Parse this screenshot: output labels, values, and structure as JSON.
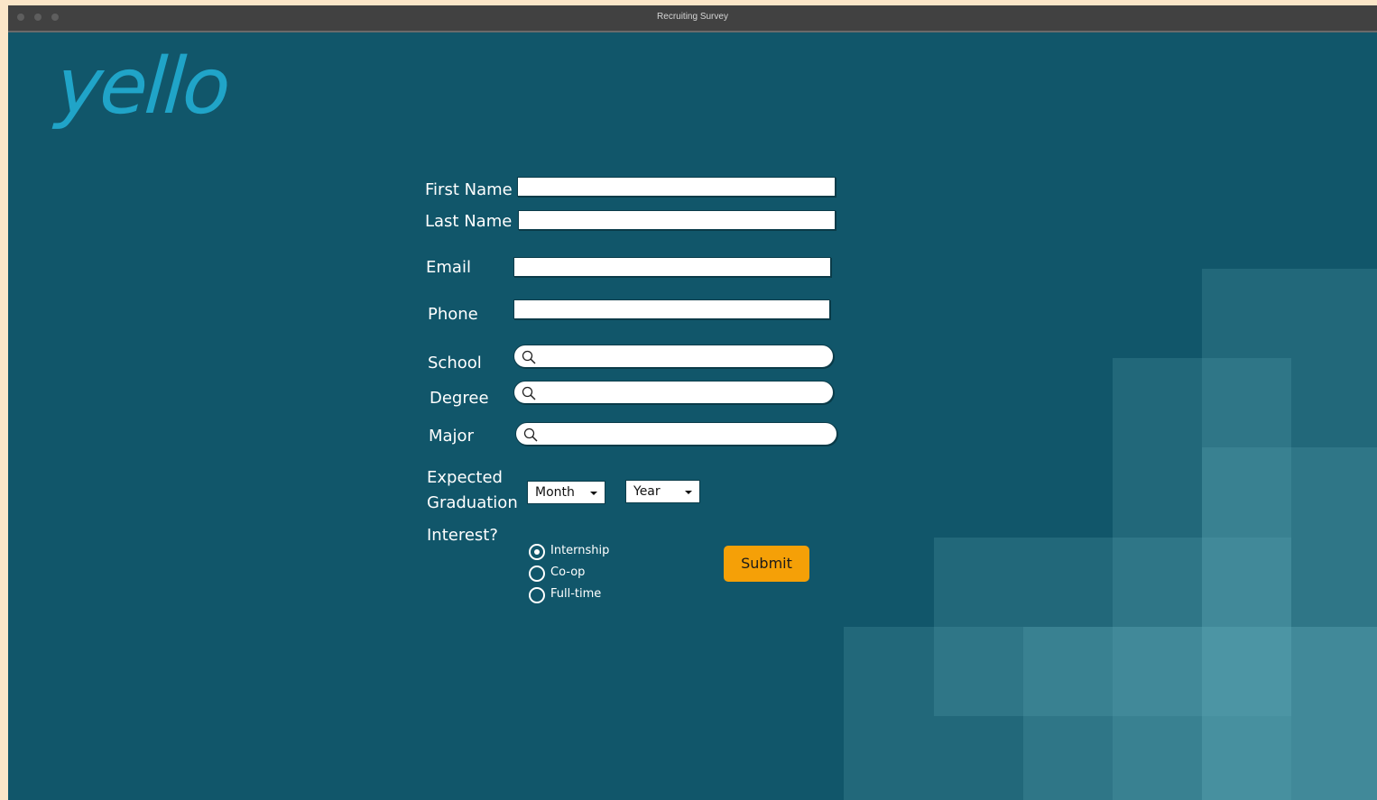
{
  "window": {
    "title": "Recruiting Survey"
  },
  "logo": {
    "text": "yello"
  },
  "form": {
    "first_name_label": "First Name",
    "last_name_label": "Last Name",
    "email_label": "Email",
    "phone_label": "Phone",
    "school_label": "School",
    "degree_label": "Degree",
    "major_label": "Major",
    "graduation_label_line1": "Expected",
    "graduation_label_line2": "Graduation",
    "month_value": "Month",
    "year_value": "Year",
    "interest_label": "Interest?",
    "interest_options": [
      "Internship",
      "Co-op",
      "Full-time"
    ],
    "interest_selected": "Internship",
    "submit_label": "Submit"
  },
  "colors": {
    "background": "#11566a",
    "logo": "#20a4c8",
    "submit": "#f5a007"
  },
  "icons": [
    "search-icon",
    "chevron-down-icon",
    "radio-icon"
  ]
}
